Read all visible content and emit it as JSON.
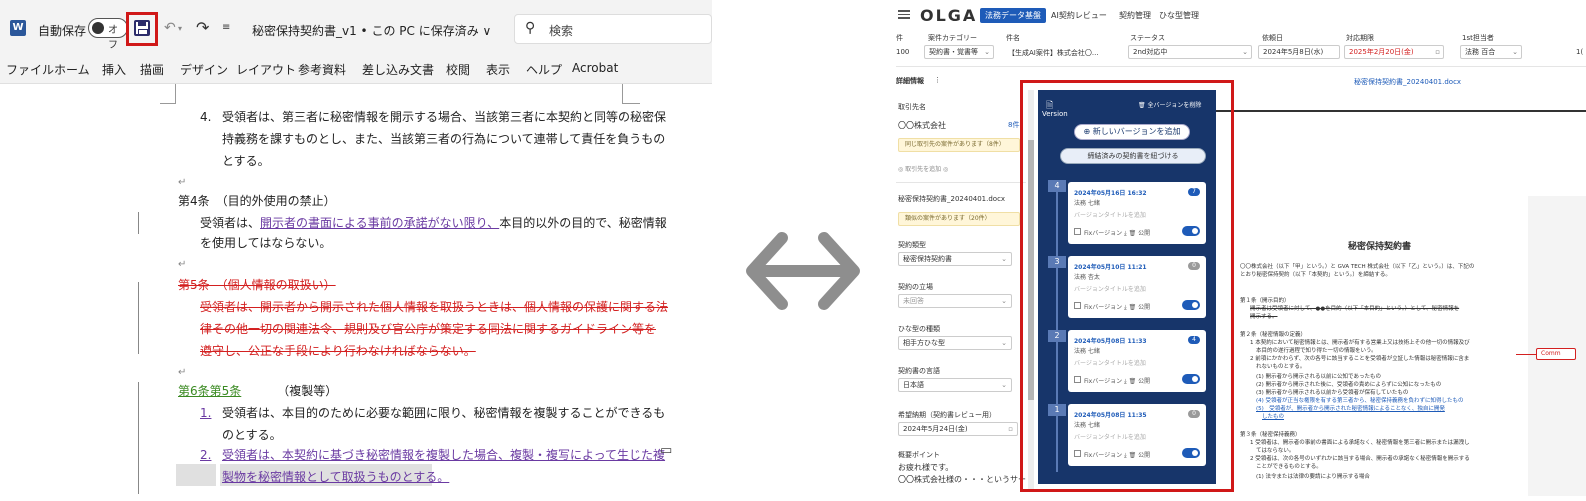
{
  "word": {
    "autosave_label": "自動保存",
    "autosave_state": "オフ",
    "doc_title": "秘密保持契約書_v1 • この PC に保存済み ∨",
    "search_placeholder": "検索",
    "ribbon_tabs": [
      "ファイル",
      "ホーム",
      "挿入",
      "描画",
      "デザイン",
      "レイアウト",
      "参考資料",
      "差し込み文書",
      "校閲",
      "表示",
      "ヘルプ",
      "Acrobat"
    ],
    "paragraphs": {
      "p4_num": "4.",
      "p4_l1": "受領者は、第三者に秘密情報を開示する場合、当該第三者に本契約と同等の秘密保",
      "p4_l2": "持義務を課すものとし、また、当該第三者の行為について連帯して責任を負うもの",
      "p4_l3": "とする。",
      "art4_title": "第4条　（目的外使用の禁止）",
      "art4_l1a": "受領者は、",
      "art4_l1b": "開示者の書面による事前の承諾がない限り、",
      "art4_l1c": "本目的以外の目的で、秘密情報",
      "art4_l2": "を使用してはならない。",
      "art5_title": "第5条　（個人情報の取扱い）",
      "art5_l1": "受領者は、開示者から開示された個人情報を取扱うときは、個人情報の保護に関する法",
      "art5_l2": "律その他一切の関連法令、規則及び官公庁が策定する同法に関するガイドライン等を",
      "art5_l3": "遵守し、公正な手段により行わなければならない。",
      "art6_title_a": "第6条第5条",
      "art6_title_b": "（複製等）",
      "art6_n1": "1.",
      "art6_1_l1": "受領者は、本目的のために必要な範囲に限り、秘密情報を複製することができるも",
      "art6_1_l2": "のとする。",
      "art6_n2": "2.",
      "art6_2_l1": "受領者は、本契約に基づき秘密情報を複製した場合、複製・複写によって生じた複",
      "art6_2_l2": "製物を秘密情報として取扱うものとする。"
    }
  },
  "olga": {
    "logo": "OLGA",
    "nav": [
      "法務データ基盤",
      "AI契約レビュー",
      "契約管理",
      "ひな型管理"
    ],
    "header_labels": [
      "件",
      "案件カテゴリー",
      "件名",
      "ステータス",
      "依頼日",
      "対応期限",
      "1st担当者"
    ],
    "row": {
      "id": "100",
      "category": "契約書・覚書等",
      "subject": "【生成AI案件】株式会社〇...",
      "status": "2nd対応中",
      "request_date": "2024年5月8日(水)",
      "deadline": "2025年2月20日(金)",
      "assignee": "法務 百合",
      "extra": "1("
    },
    "detail_label": "詳細情報",
    "file_link": "秘密保持契約書_20240401.docx",
    "sidebar": {
      "partner_label": "取引先名",
      "partner_value": "〇〇株式会社",
      "partner_count": "8件",
      "partner_note": "同じ取引先の案件があります（8件）",
      "partner_add": "◎ 取引先を追加 ◎",
      "file_name": "秘密保持契約書_20240401.docx",
      "file_note": "類似の案件があります（20件）",
      "contract_type_label": "契約類型",
      "contract_type_value": "秘密保持契約書",
      "position_label": "契約の立場",
      "position_value": "未回答",
      "template_label": "ひな型の種類",
      "template_value": "相手方ひな型",
      "language_label": "契約書の言語",
      "language_value": "日本語",
      "desired_date_label": "希望納期（契約書レビュー用）",
      "desired_date_value": "2024年5月24日(金)",
      "summary_label": "概要ポイント",
      "summary_l1": "お疲れ様です。",
      "summary_l2": "〇〇株式会社様の・・・というサー"
    },
    "version_panel": {
      "title": "Version",
      "delete_all": "全バージョンを削除",
      "add_version": "⊕ 新しいバージョンを追加",
      "signed_button": "締結済みの契約書を紐づける",
      "placeholder": "バージョンタイトルを追加",
      "fix_label": "Fixバージョン",
      "public_label": "公開",
      "versions": [
        {
          "num": "4",
          "date": "2024年05月16日 16:32",
          "user": "法務 七緒",
          "badge": "7"
        },
        {
          "num": "3",
          "date": "2024年05月10日 11:21",
          "user": "法務 杏太",
          "badge": "0"
        },
        {
          "num": "2",
          "date": "2024年05月08日 11:33",
          "user": "法務 七緒",
          "badge": "4"
        },
        {
          "num": "1",
          "date": "2024年05月08日 11:35",
          "user": "法務 七緒",
          "badge": "0"
        }
      ]
    },
    "doc_preview": {
      "title": "秘密保持契約書",
      "intro_l1": "〇〇株式会社（以下「甲」という。）と GVA TECH 株式会社（以下「乙」という。）は、下記の",
      "intro_l2": "とおり秘密保持契約（以下「本契約」という。）を締結する。",
      "a1_title": "第１条（開示目的）",
      "a1_l1": "開示者は受領者に対して、●●を目的（以下「本目的」という。）として、秘密情報を",
      "a1_l2": "開示する。",
      "a2_title": "第２条（秘密情報の定義）",
      "a2_l1": "1 本契約において秘密情報とは、開示者が有する営業上又は技術上その他一切の情報及び",
      "a2_l2": "本目的の遂行過程で知り得た一切の情報をいう。",
      "a2_l3": "2 前項にかかわらず、次の各号に該当することを受領者が立証した情報は秘密情報に含ま",
      "a2_l4": "れないものとする。",
      "a2_i1": "(1) 開示者から開示される以前に公知であったもの",
      "a2_i2": "(2) 開示者から開示された後に、受領者の責めによらずに公知になったもの",
      "a2_i3": "(3) 開示者から開示される以前から受領者が保有していたもの",
      "a2_i4": "(4) 受領者が正当な権限を有する第三者から、秘密保持義務を負わずに知得したもの",
      "a2_i5": "(5)　受領者が、開示者から開示された秘密情報によることなく、独自に開発",
      "a2_i5b": "したもの",
      "a3_title": "第３条（秘密保持義務）",
      "a3_l1": "1 受領者は、開示者の事前の書面による承諾なく、秘密情報を第三者に開示または漏洩し",
      "a3_l2": "てはならない。",
      "a3_l3": "2 受領者は、次の各号のいずれかに該当する場合、開示者の承諾なく秘密情報を開示する",
      "a3_l4": "ことができるものとする。",
      "a3_l5": "(1) 法令または法律の要請により開示する場合",
      "comment_tag": "Comm"
    }
  },
  "colors": {
    "highlight_red": "#d01818",
    "olga_blue": "#1e5bb8",
    "panel_navy": "#17356a",
    "deleted_red": "#d32020",
    "inserted_green": "#3a8a22",
    "inserted_purple": "#6a3aa2"
  }
}
